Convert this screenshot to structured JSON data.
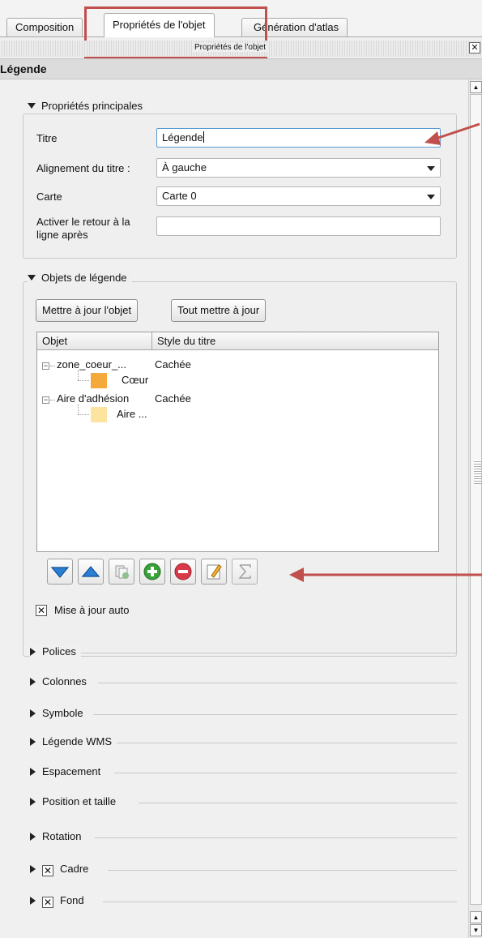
{
  "tabs": [
    {
      "label": "Composition"
    },
    {
      "label": "Propriétés de l'objet"
    },
    {
      "label": "Génération d'atlas"
    }
  ],
  "dock": {
    "title": "Propriétés de l'objet",
    "close_icon": "close-icon"
  },
  "section": {
    "title": "Légende"
  },
  "main_props": {
    "header": "Propriétés principales",
    "title_label": "Titre",
    "title_value": "Légende",
    "alignment_label": "Alignement du titre :",
    "alignment_value": "À gauche",
    "map_label": "Carte",
    "map_value": "Carte 0",
    "wrap_label_line1": "Activer le retour à la",
    "wrap_label_line2": "ligne après",
    "wrap_value": ""
  },
  "legend_items": {
    "header": "Objets de légende",
    "update_item_button": "Mettre à jour l'objet",
    "update_all_button": "Tout mettre à jour",
    "columns": [
      "Objet",
      "Style du titre"
    ],
    "rows": [
      {
        "object": "zone_coeur_...",
        "style": "Cachée",
        "children": [
          {
            "label": "Cœur",
            "color": "#f4a93b"
          }
        ]
      },
      {
        "object": "Aire d'adhésion",
        "style": "Cachée",
        "children": [
          {
            "label": "Aire ...",
            "color": "#fde3a0"
          }
        ]
      }
    ],
    "tools": [
      "move-down-icon",
      "move-up-icon",
      "group-add-icon",
      "add-icon",
      "remove-icon",
      "edit-icon",
      "count-icon"
    ],
    "auto_update_label": "Mise à jour auto",
    "auto_update_checked": true
  },
  "collapsed_sections": [
    {
      "label": "Polices",
      "checkbox": false
    },
    {
      "label": "Colonnes",
      "checkbox": false
    },
    {
      "label": "Symbole",
      "checkbox": false
    },
    {
      "label": "Légende WMS",
      "checkbox": false
    },
    {
      "label": "Espacement",
      "checkbox": false
    },
    {
      "label": "Position et taille",
      "checkbox": false
    },
    {
      "label": "Rotation",
      "checkbox": false
    },
    {
      "label": "Cadre",
      "checkbox": true
    },
    {
      "label": "Fond",
      "checkbox": true
    }
  ],
  "colors": {
    "highlight": "#c0504d",
    "focus": "#5b9bd5"
  }
}
